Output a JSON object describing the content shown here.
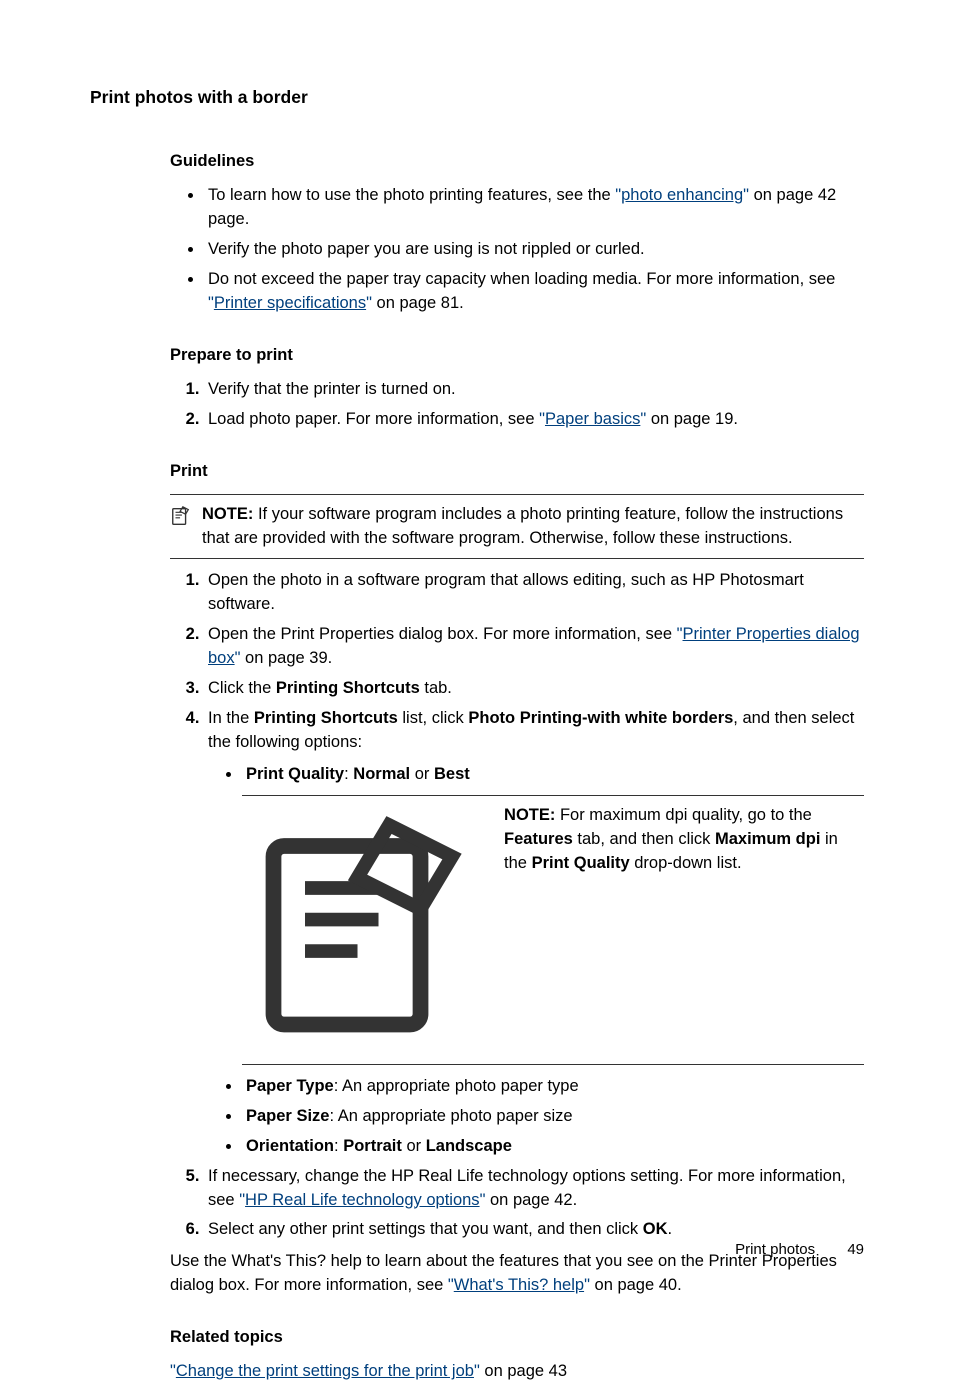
{
  "page_title": "Print photos with a border",
  "sections": {
    "guidelines": {
      "heading": "Guidelines",
      "item1a": "To learn how to use the photo printing features, see the ",
      "item1_link": "photo enhancing",
      "item1b": " on page 42 page.",
      "item2": "Verify the photo paper you are using is not rippled or curled.",
      "item3a": "Do not exceed the paper tray capacity when loading media. For more information, see ",
      "item3_link": "Printer specifications",
      "item3b": " on page 81."
    },
    "prepare": {
      "heading": "Prepare to print",
      "step1": "Verify that the printer is turned on.",
      "step2a": "Load photo paper. For more information, see ",
      "step2_link": "Paper basics",
      "step2b": " on page 19."
    },
    "print": {
      "heading": "Print",
      "note_label": "NOTE:",
      "note_text": "If your software program includes a photo printing feature, follow the instructions that are provided with the software program. Otherwise, follow these instructions.",
      "step1": "Open the photo in a software program that allows editing, such as HP Photosmart software.",
      "step2a": "Open the Print Properties dialog box. For more information, see ",
      "step2_link": "Printer Properties dialog box",
      "step2b": " on page 39.",
      "step3a": "Click the ",
      "step3_bold": "Printing Shortcuts",
      "step3b": " tab.",
      "step4a": "In the ",
      "step4_b1": "Printing Shortcuts",
      "step4b": " list, click ",
      "step4_b2": "Photo Printing-with white borders",
      "step4c": ", and then select the following options:",
      "sub1_b1": "Print Quality",
      "sub1_mid": ": ",
      "sub1_b2": "Normal",
      "sub1_or": " or ",
      "sub1_b3": "Best",
      "inner_note_label": "NOTE:",
      "inner_note_a": "For maximum dpi quality, go to the ",
      "inner_note_b1": "Features",
      "inner_note_b": " tab, and then click ",
      "inner_note_b2": "Maximum dpi",
      "inner_note_c": " in the ",
      "inner_note_b3": "Print Quality",
      "inner_note_d": " drop-down list.",
      "sub2_b": "Paper Type",
      "sub2_rest": ": An appropriate photo paper type",
      "sub3_b": "Paper Size",
      "sub3_rest": ": An appropriate photo paper size",
      "sub4_b1": "Orientation",
      "sub4_mid": ": ",
      "sub4_b2": "Portrait",
      "sub4_or": " or ",
      "sub4_b3": "Landscape",
      "step5a": "If necessary, change the HP Real Life technology options setting. For more information, see ",
      "step5_link": "HP Real Life technology options",
      "step5b": " on page 42.",
      "step6a": "Select any other print settings that you want, and then click ",
      "step6_b": "OK",
      "step6b": ".",
      "trail_a": "Use the What's This? help to learn about the features that you see on the Printer Properties dialog box. For more information, see ",
      "trail_link": "What's This? help",
      "trail_b": " on page 40."
    },
    "related": {
      "heading": "Related topics",
      "link": "Change the print settings for the print job",
      "rest": " on page 43"
    }
  },
  "footer": {
    "section": "Print photos",
    "page": "49"
  }
}
